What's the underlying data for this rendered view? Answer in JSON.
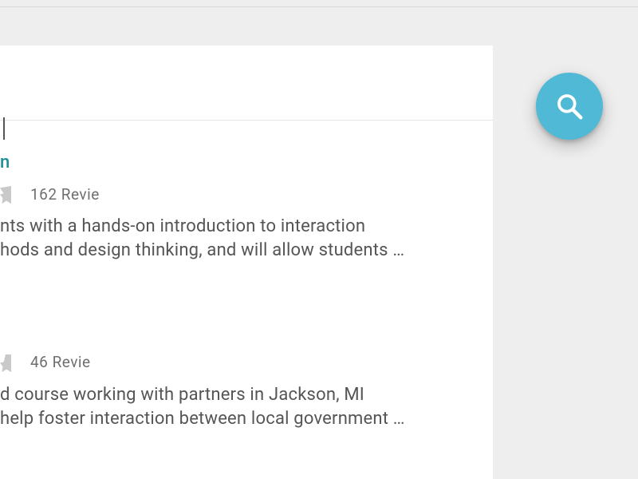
{
  "search": {
    "value": ""
  },
  "results": [
    {
      "title_fragment": "n",
      "star_partial": true,
      "reviews_fragment": "162 Revie",
      "desc_line1": "nts with a hands-on introduction to interaction",
      "desc_line2": "hods and design thinking, and will allow students …"
    },
    {
      "title_fragment": "",
      "star_partial": true,
      "reviews_fragment": "46 Revie",
      "desc_line1": "d course working with partners in Jackson, MI",
      "desc_line2": "help foster interaction between local government …"
    }
  ],
  "fab": {
    "icon": "search-icon"
  }
}
